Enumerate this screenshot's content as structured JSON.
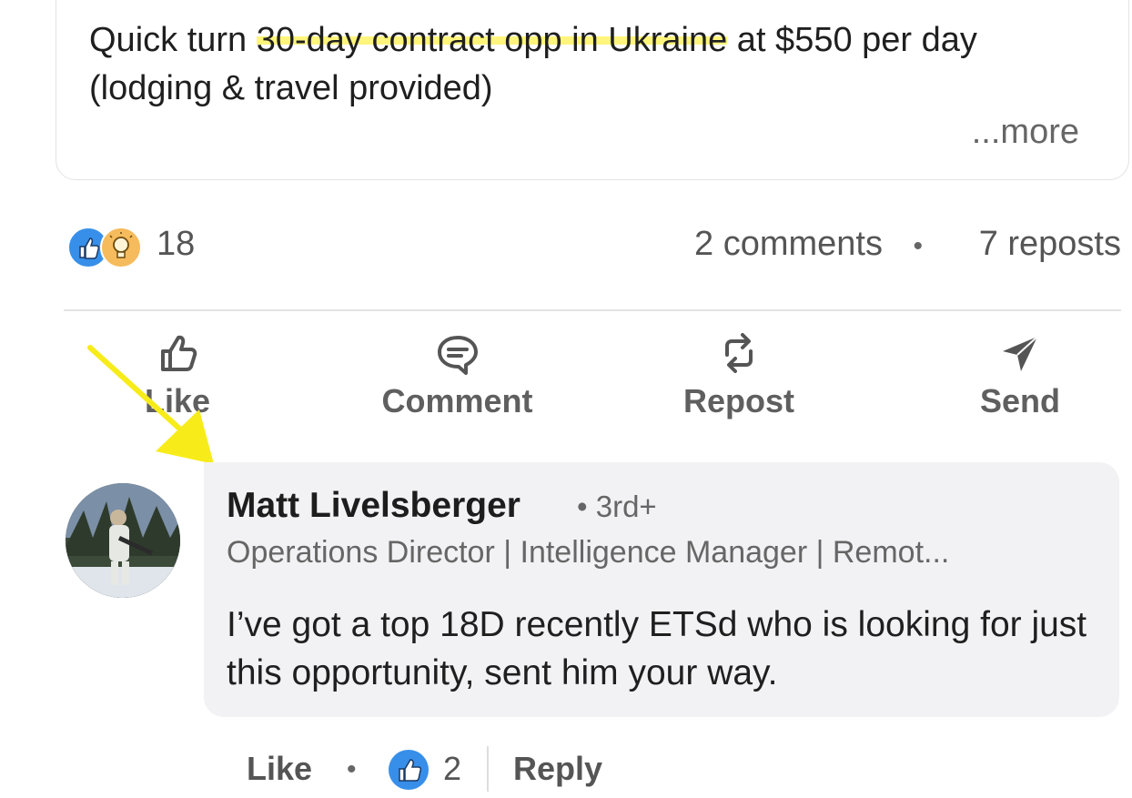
{
  "post": {
    "text_before": "Quick turn ",
    "text_highlight": "30-day contract opp in Ukraine",
    "text_after": " at $550 per day",
    "text_line3": "(lodging & travel provided)",
    "more_label": "...more"
  },
  "stats": {
    "reaction_count": "18",
    "comments": "2 comments",
    "separator": "•",
    "reposts": "7 reposts"
  },
  "actions": {
    "like": "Like",
    "comment": "Comment",
    "repost": "Repost",
    "send": "Send"
  },
  "comment": {
    "name": "Matt Livelsberger",
    "degree": "• 3rd+",
    "headline": "Operations Director | Intelligence Manager | Remot...",
    "text": "I’ve got a top 18D recently ETSd who is looking for just this opportunity, sent him your way.",
    "actions": {
      "like": "Like",
      "separator": "•",
      "reaction_count": "2",
      "reply": "Reply"
    }
  },
  "colors": {
    "highlight": "#fff250",
    "annotation_arrow": "#f7ec1a",
    "like_blue": "#378fe9",
    "insight_gold": "#f5bb5c"
  }
}
